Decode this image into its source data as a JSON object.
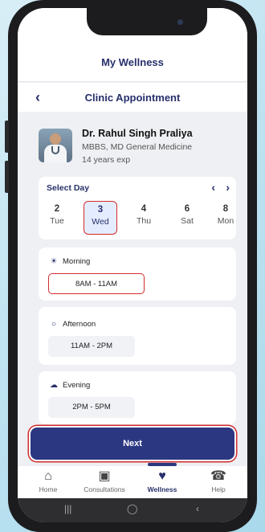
{
  "app": {
    "title": "My Wellness"
  },
  "page": {
    "title": "Clinic Appointment"
  },
  "doctor": {
    "name": "Dr. Rahul Singh Praliya",
    "degree": "MBBS, MD General Medicine",
    "experience": "14 years exp"
  },
  "day_selector": {
    "label": "Select Day",
    "prev_icon": "chevron-left-icon",
    "next_icon": "chevron-right-icon",
    "days": [
      {
        "num": "2",
        "dow": "Tue",
        "selected": false
      },
      {
        "num": "3",
        "dow": "Wed",
        "selected": true
      },
      {
        "num": "4",
        "dow": "Thu",
        "selected": false
      },
      {
        "num": "6",
        "dow": "Sat",
        "selected": false
      },
      {
        "num": "8",
        "dow": "Mon",
        "selected": false
      }
    ]
  },
  "slots": {
    "morning": {
      "label": "Morning",
      "time": "8AM - 11AM",
      "icon": "sunrise-icon",
      "selected": true
    },
    "afternoon": {
      "label": "Afternoon",
      "time": "11AM - 2PM",
      "icon": "sun-icon",
      "selected": false
    },
    "evening": {
      "label": "Evening",
      "time": "2PM - 5PM",
      "icon": "cloud-moon-icon",
      "selected": false
    }
  },
  "next_button": {
    "label": "Next"
  },
  "tabbar": {
    "items": [
      {
        "label": "Home",
        "icon": "home-icon"
      },
      {
        "label": "Consultations",
        "icon": "clinic-icon"
      },
      {
        "label": "Wellness",
        "icon": "heart-icon",
        "active": true
      },
      {
        "label": "Help",
        "icon": "headset-icon"
      }
    ]
  },
  "colors": {
    "primary": "#2b3780",
    "highlight": "#d22b2b",
    "accent_bg": "#e4ecff"
  }
}
